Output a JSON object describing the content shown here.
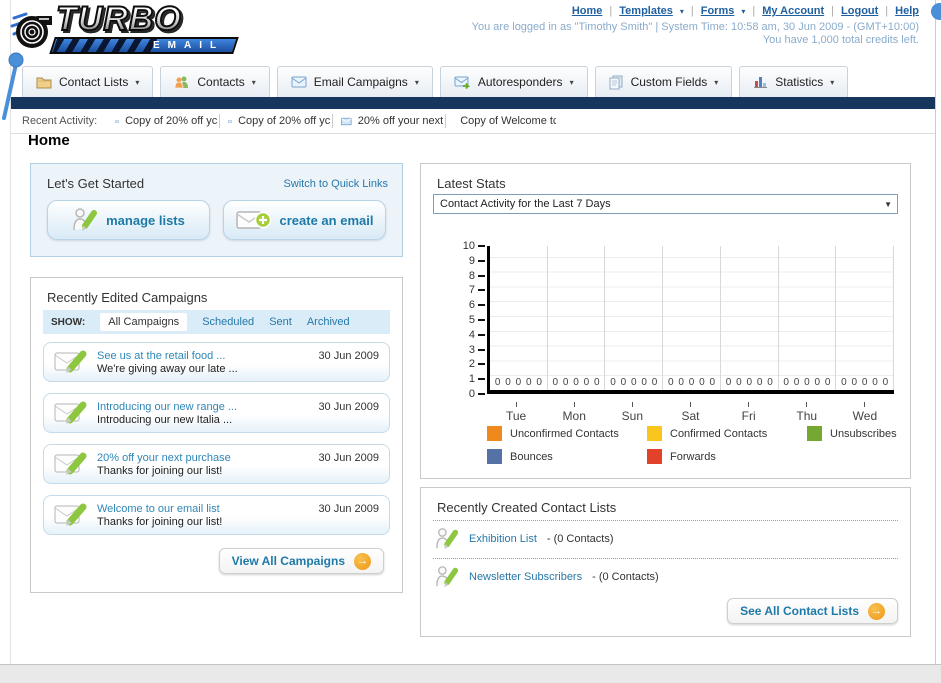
{
  "header": {
    "logo_title": "TURBO",
    "logo_subtitle": "EMAIL",
    "links": {
      "home": "Home",
      "templates": "Templates",
      "forms": "Forms",
      "my_account": "My Account",
      "logout": "Logout",
      "help": "Help"
    },
    "login_line": "You are logged in as \"Timothy Smith\" | System Time: 10:58 am, 30 Jun 2009 - (GMT+10:00)",
    "credits_line": "You have 1,000 total credits left."
  },
  "nav": {
    "tabs": [
      {
        "label": "Contact Lists",
        "icon": "folder-icon"
      },
      {
        "label": "Contacts",
        "icon": "contacts-icon"
      },
      {
        "label": "Email Campaigns",
        "icon": "envelope-icon"
      },
      {
        "label": "Autoresponders",
        "icon": "envelope-arrow-icon"
      },
      {
        "label": "Custom Fields",
        "icon": "pages-icon"
      },
      {
        "label": "Statistics",
        "icon": "bar-chart-icon"
      }
    ]
  },
  "recent_activity": {
    "label": "Recent Activity:",
    "items": [
      "Copy of 20% off yc",
      "Copy of 20% off yc",
      "20% off your next",
      "Copy of Welcome tc"
    ]
  },
  "page_title": "Home",
  "get_started": {
    "title": "Let's Get Started",
    "switch_link": "Switch to Quick Links",
    "manage_lists_label": "manage lists",
    "create_email_label": "create an email"
  },
  "campaigns": {
    "title": "Recently Edited Campaigns",
    "show_label": "SHOW:",
    "tabs": [
      "All Campaigns",
      "Scheduled",
      "Sent",
      "Archived"
    ],
    "active_tab": "All Campaigns",
    "items": [
      {
        "title": "See us at the retail food ...",
        "subtitle": "We're giving away our late ...",
        "date": "30 Jun 2009"
      },
      {
        "title": "Introducing our new range ...",
        "subtitle": "Introducing our new Italia ...",
        "date": "30 Jun 2009"
      },
      {
        "title": "20% off your next purchase",
        "subtitle": "Thanks for joining our list!",
        "date": "30 Jun 2009"
      },
      {
        "title": "Welcome to our email list",
        "subtitle": "Thanks for joining our list!",
        "date": "30 Jun 2009"
      }
    ],
    "view_all_label": "View All Campaigns"
  },
  "stats": {
    "title": "Latest Stats",
    "dropdown_value": "Contact Activity for the Last 7 Days"
  },
  "chart_data": {
    "type": "bar",
    "title": "Contact Activity for the Last 7 Days",
    "categories": [
      "Tue",
      "Mon",
      "Sun",
      "Sat",
      "Fri",
      "Thu",
      "Wed"
    ],
    "series": [
      {
        "name": "Unconfirmed Contacts",
        "color": "#f0891d",
        "values": [
          0,
          0,
          0,
          0,
          0,
          0,
          0
        ]
      },
      {
        "name": "Confirmed Contacts",
        "color": "#f8c61c",
        "values": [
          0,
          0,
          0,
          0,
          0,
          0,
          0
        ]
      },
      {
        "name": "Unsubscribes",
        "color": "#74a832",
        "values": [
          0,
          0,
          0,
          0,
          0,
          0,
          0
        ]
      },
      {
        "name": "Bounces",
        "color": "#5572a7",
        "values": [
          0,
          0,
          0,
          0,
          0,
          0,
          0
        ]
      },
      {
        "name": "Forwards",
        "color": "#e2422a",
        "values": [
          0,
          0,
          0,
          0,
          0,
          0,
          0
        ]
      }
    ],
    "xlabel": "",
    "ylabel": "",
    "ylim": [
      0,
      10
    ],
    "yticks": [
      0,
      1,
      2,
      3,
      4,
      5,
      6,
      7,
      8,
      9,
      10
    ],
    "grid": true,
    "legend_position": "bottom",
    "value_labels": "each bar labeled 0 above baseline"
  },
  "contact_lists": {
    "title": "Recently Created Contact Lists",
    "items": [
      {
        "name": "Exhibition List",
        "detail": "- (0 Contacts)"
      },
      {
        "name": "Newsletter Subscribers",
        "detail": "- (0 Contacts)"
      }
    ],
    "see_all_label": "See All Contact Lists"
  }
}
